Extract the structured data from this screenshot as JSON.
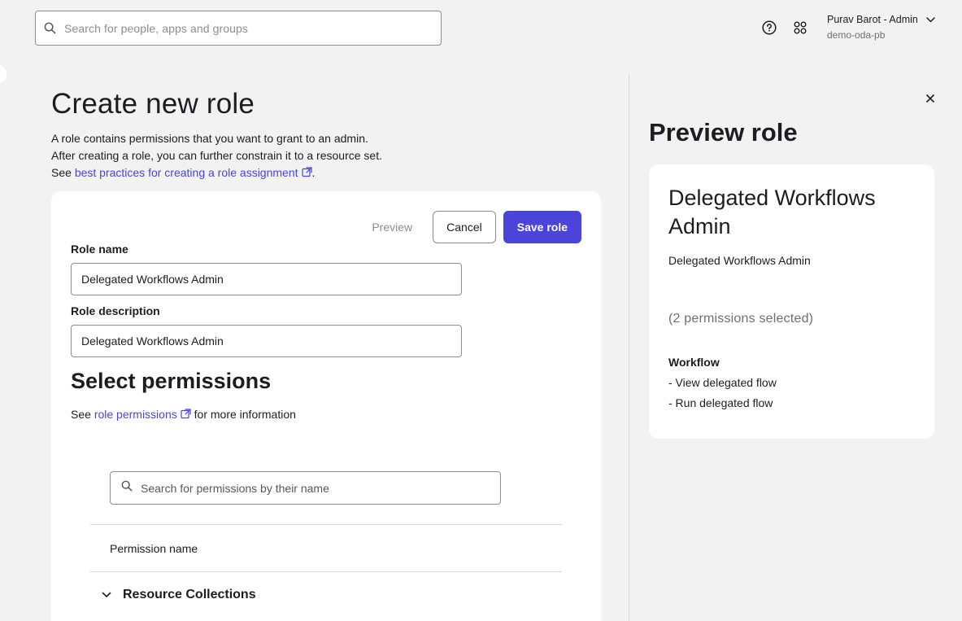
{
  "header": {
    "search_placeholder": "Search for people, apps and groups",
    "user_name": "Purav Barot - Admin",
    "org": "demo-oda-pb"
  },
  "main": {
    "title": "Create new role",
    "intro_line1": "A role contains permissions that you want to grant to an admin.",
    "intro_line2": "After creating a role, you can further constrain it to a resource set.",
    "intro_see": "See ",
    "intro_link": "best practices for creating a role assignment",
    "intro_end": ".",
    "buttons": {
      "preview": "Preview",
      "cancel": "Cancel",
      "save": "Save role"
    },
    "role_name_label": "Role name",
    "role_name_value": "Delegated Workflows Admin",
    "role_desc_label": "Role description",
    "role_desc_value": "Delegated Workflows Admin",
    "permissions_title": "Select permissions",
    "permissions_see": "See ",
    "permissions_link": "role permissions",
    "permissions_more": " for more information",
    "permissions_search_placeholder": "Search for permissions by their name",
    "column_header": "Permission name",
    "groups": [
      {
        "label": "Resource Collections"
      }
    ]
  },
  "preview": {
    "title": "Preview role",
    "role_title": "Delegated Workflows Admin",
    "role_desc": "Delegated Workflows Admin",
    "count": "(2 permissions selected)",
    "group": "Workflow",
    "items": [
      "- View delegated flow",
      "- Run delegated flow"
    ]
  },
  "colors": {
    "accent": "#4b44d8",
    "background": "#f2f2f2"
  }
}
